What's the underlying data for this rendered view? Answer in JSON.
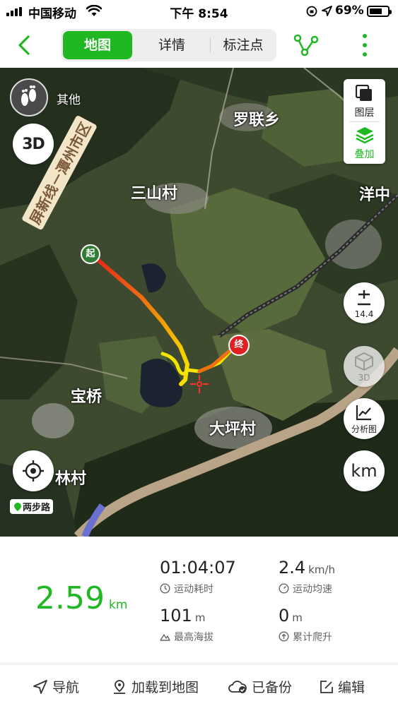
{
  "status_bar": {
    "carrier": "中国移动",
    "time": "下午 8:54",
    "battery_percent": "69%"
  },
  "navbar": {
    "tabs": [
      {
        "label": "地图",
        "active": true
      },
      {
        "label": "详情",
        "active": false
      },
      {
        "label": "标注点",
        "active": false
      }
    ]
  },
  "map": {
    "mode_label": "其他",
    "labels": {
      "village1": "三山村",
      "village2": "罗联乡",
      "village3": "洋中",
      "village4": "宝桥",
      "village5": "大坪村",
      "village6": "林村",
      "road": "屏新线－潭州市区"
    },
    "start_marker": "起",
    "end_marker": "终",
    "controls": {
      "layers_label": "图层",
      "overlay_label": "叠加",
      "zoom_level": "14.4",
      "threed_label": "3D",
      "analysis_label": "分析图",
      "unit_label": "km",
      "threed_button": "3D"
    },
    "brand": "两步路"
  },
  "stats": {
    "distance": {
      "value": "2.59",
      "unit": "km"
    },
    "items": [
      {
        "value": "01:04:07",
        "unit": "",
        "caption": "运动耗时",
        "icon": "clock-icon"
      },
      {
        "value": "2.4",
        "unit": "km/h",
        "caption": "运动均速",
        "icon": "speedometer-icon"
      },
      {
        "value": "101",
        "unit": "m",
        "caption": "最高海拔",
        "icon": "mountain-icon"
      },
      {
        "value": "0",
        "unit": "m",
        "caption": "累计爬升",
        "icon": "arrow-up-icon"
      }
    ]
  },
  "bottom_bar": {
    "navigate": "导航",
    "load_to_map": "加载到地图",
    "backed_up": "已备份",
    "edit": "编辑"
  },
  "colors": {
    "accent": "#1fb822",
    "track_start": "#e0201a",
    "track_end": "#f5e400"
  }
}
